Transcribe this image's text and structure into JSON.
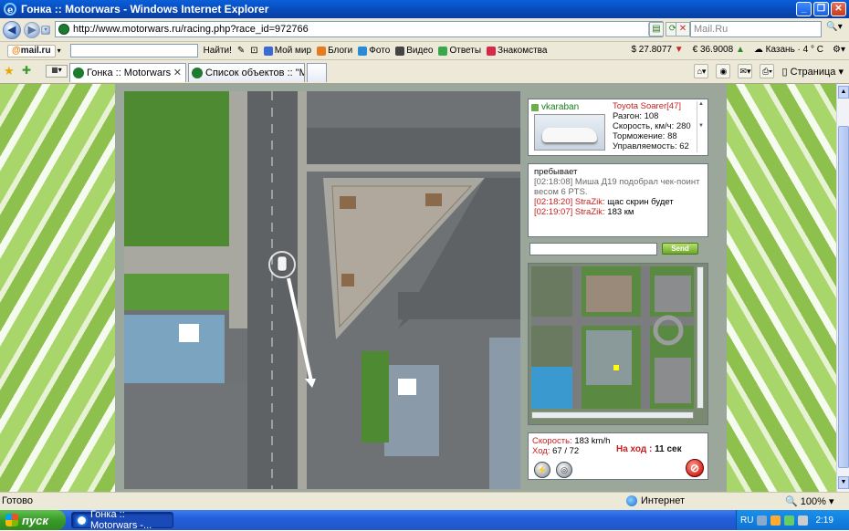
{
  "window": {
    "title": "Гонка :: Motorwars - Windows Internet Explorer"
  },
  "address": {
    "url": "http://www.motorwars.ru/racing.php?race_id=972766",
    "search_placeholder": "Mail.Ru"
  },
  "mailbar": {
    "logo_prefix": "@",
    "logo_text": "mail.ru",
    "find_label": "Найти!",
    "items": [
      "Мой мир",
      "Блоги",
      "Фото",
      "Видео",
      "Ответы",
      "Знакомства"
    ],
    "usd": "$ 27.8077",
    "eur": "€ 36.9008",
    "weather": "Казань · 4 ° C"
  },
  "tabs": [
    {
      "label": "Гонка :: Motorwars"
    },
    {
      "label": "Список объектов :: \"Мо..."
    }
  ],
  "tools": {
    "page_label": "Страница"
  },
  "car": {
    "user": "vkaraban",
    "name": "Toyota Soarer[47]",
    "accel": "Разгон: 108",
    "speed": "Скорость, км/ч: 280",
    "brakes": "Торможение: 88",
    "handling": "Управляемость: 62"
  },
  "chat": {
    "system_1": "пребывает",
    "system_2": "",
    "lines": [
      {
        "time": "[02:18:08]",
        "text": "Миша Д19 подобрал чек-поинт весом 6 PTS.",
        "grey": true
      },
      {
        "time": "[02:18:20]",
        "name": "StraZik:",
        "text": "щас скрин будет",
        "grey": false
      },
      {
        "time": "[02:19:07]",
        "name": "StraZik:",
        "text": "183 км",
        "grey": false
      }
    ],
    "send_label": "Send"
  },
  "info": {
    "speed_label": "Скорость:",
    "speed_value": "183 km/h",
    "move_label": "Ход:",
    "move_value": "67 / 72",
    "turn_label": "На ход :",
    "turn_value": "11 сек"
  },
  "status": {
    "ready": "Готово",
    "zone": "Интернет",
    "zoom": "100%"
  },
  "taskbar": {
    "start": "пуск",
    "task": "Гонка :: Motorwars -...",
    "lang": "RU",
    "clock": "2:19"
  }
}
